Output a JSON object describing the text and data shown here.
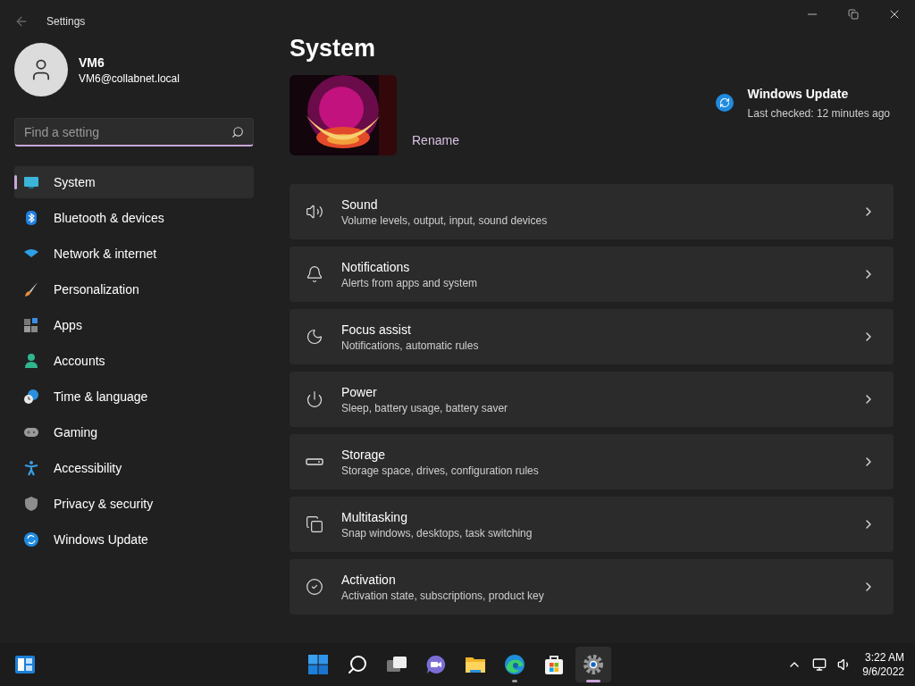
{
  "window": {
    "title": "Settings"
  },
  "user": {
    "name": "VM6",
    "email": "VM6@collabnet.local"
  },
  "search": {
    "placeholder": "Find a setting"
  },
  "nav": [
    {
      "label": "System",
      "selected": true
    },
    {
      "label": "Bluetooth & devices",
      "selected": false
    },
    {
      "label": "Network & internet",
      "selected": false
    },
    {
      "label": "Personalization",
      "selected": false
    },
    {
      "label": "Apps",
      "selected": false
    },
    {
      "label": "Accounts",
      "selected": false
    },
    {
      "label": "Time & language",
      "selected": false
    },
    {
      "label": "Gaming",
      "selected": false
    },
    {
      "label": "Accessibility",
      "selected": false
    },
    {
      "label": "Privacy & security",
      "selected": false
    },
    {
      "label": "Windows Update",
      "selected": false
    }
  ],
  "page": {
    "title": "System",
    "device_action": "Rename"
  },
  "update": {
    "title": "Windows Update",
    "status": "Last checked: 12 minutes ago"
  },
  "settings": [
    {
      "title": "Sound",
      "subtitle": "Volume levels, output, input, sound devices"
    },
    {
      "title": "Notifications",
      "subtitle": "Alerts from apps and system"
    },
    {
      "title": "Focus assist",
      "subtitle": "Notifications, automatic rules"
    },
    {
      "title": "Power",
      "subtitle": "Sleep, battery usage, battery saver"
    },
    {
      "title": "Storage",
      "subtitle": "Storage space, drives, configuration rules"
    },
    {
      "title": "Multitasking",
      "subtitle": "Snap windows, desktops, task switching"
    },
    {
      "title": "Activation",
      "subtitle": "Activation state, subscriptions, product key"
    }
  ],
  "taskbar": {
    "apps": [
      {
        "selected": false,
        "running": false
      },
      {
        "selected": false,
        "running": false
      },
      {
        "selected": false,
        "running": false
      },
      {
        "selected": false,
        "running": false
      },
      {
        "selected": false,
        "running": false
      },
      {
        "selected": false,
        "running": true
      },
      {
        "selected": false,
        "running": false
      },
      {
        "selected": true,
        "running": true
      }
    ],
    "time": "3:22 AM",
    "date": "9/6/2022"
  }
}
